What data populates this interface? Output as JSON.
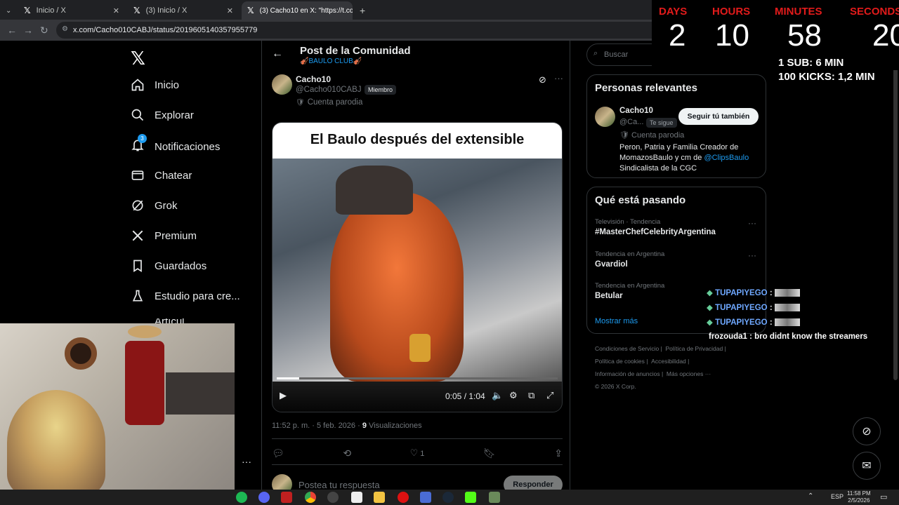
{
  "browser": {
    "tabs": [
      {
        "label": "Inicio / X"
      },
      {
        "label": "(3) Inicio / X"
      },
      {
        "label": "(3) Cacho10 en X: \"https://t.co/…"
      }
    ],
    "url": "x.com/Cacho010CABJ/status/2019605140357955779"
  },
  "sidebar": {
    "items": [
      {
        "label": "Inicio",
        "icon": "home-icon"
      },
      {
        "label": "Explorar",
        "icon": "search-icon"
      },
      {
        "label": "Notificaciones",
        "icon": "bell-icon",
        "badge": "3"
      },
      {
        "label": "Chatear",
        "icon": "mail-icon"
      },
      {
        "label": "Grok",
        "icon": "grok-icon"
      },
      {
        "label": "Premium",
        "icon": "x-logo-icon"
      },
      {
        "label": "Guardados",
        "icon": "bookmark-icon"
      },
      {
        "label": "Estudio para cre...",
        "icon": "flask-icon"
      }
    ],
    "partial_item": "Artícul..."
  },
  "post": {
    "header_title": "Post de la Comunidad",
    "community": "🎻BAULO CLUB🎻",
    "author_name": "Cacho10",
    "author_handle": "@Cacho010CABJ",
    "member_badge": "Miembro",
    "parody_label": "Cuenta parodia",
    "video_title": "El Baulo después del extensible",
    "video_time": "0:05 / 1:04",
    "video_progress": 0.08,
    "timestamp": "11:52 p. m. · 5 feb. 2026 · ",
    "views_count": "9",
    "views_label": " Visualizaciones",
    "likes": "1",
    "reply_placeholder": "Postea tu respuesta",
    "reply_button": "Responder"
  },
  "right": {
    "search_placeholder": "Buscar",
    "relevant_title": "Personas relevantes",
    "person": {
      "name": "Cacho10",
      "handle": "@Ca...",
      "follows_you": "Te sigue",
      "follow_button": "Seguir tú también",
      "parody": "Cuenta parodia",
      "bio_text": "Peron, Patria y Familia Creador de MomazosBaulo y cm de ",
      "bio_link": "@ClipsBaulo",
      "bio_tail": " Sindicalista de la CGC"
    },
    "trending_title": "Qué está pasando",
    "trends": [
      {
        "category": "Televisión · Tendencia",
        "name": "#MasterChefCelebrityArgentina"
      },
      {
        "category": "Tendencia en Argentina",
        "name": "Gvardiol"
      },
      {
        "category": "Tendencia en Argentina",
        "name": "Betular"
      }
    ],
    "show_more": "Mostrar más",
    "footer": {
      "links": [
        "Condiciones de Servicio",
        "Política de Privacidad",
        "Política de cookies",
        "Accesibilidad",
        "Información de anuncios",
        "Más opciones ···"
      ],
      "copyright": "© 2026 X Corp."
    }
  },
  "overlay": {
    "timer": {
      "labels": [
        "DAYS",
        "HOURS",
        "MINUTES",
        "SECONDS"
      ],
      "values": [
        "2",
        "10",
        "58",
        "20"
      ]
    },
    "sub_rule": "1 SUB: 6 MIN",
    "kick_rule": "100 KICKS: 1,2 MIN",
    "chat": [
      {
        "user": "TUPAPIYEGO",
        "text": ""
      },
      {
        "user": "TUPAPIYEGO",
        "text": ""
      },
      {
        "user": "TUPAPIYEGO",
        "text": ""
      },
      {
        "user": "frozouda1",
        "text": " : bro didnt know the streamers"
      }
    ]
  },
  "taskbar": {
    "lang": "ESP",
    "time": "11:58 PM",
    "date": "2/5/2026"
  },
  "colors": {
    "accent": "#1d9bf0",
    "timer_label": "#e21b1b",
    "chat_user": "#6fa8ff"
  }
}
